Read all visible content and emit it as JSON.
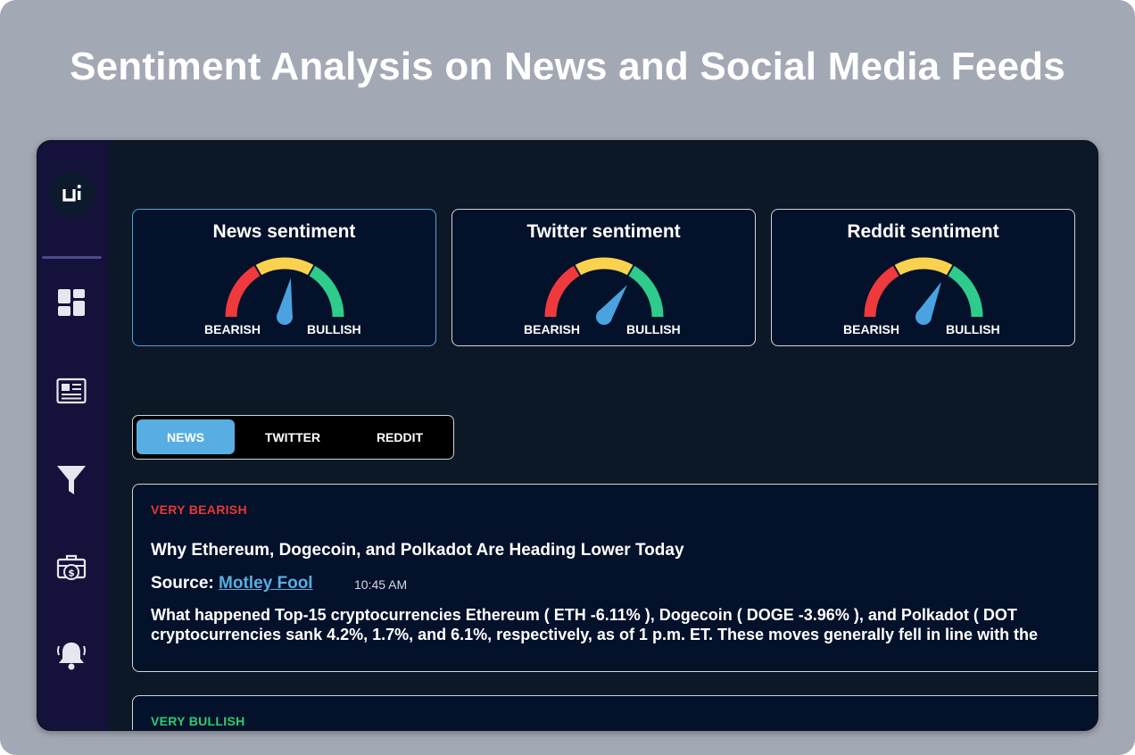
{
  "headline": "Sentiment Analysis on News and Social Media Feeds",
  "sidebar": {
    "logo_text": "ui",
    "icons": [
      "dashboard-icon",
      "newspaper-icon",
      "filter-icon",
      "briefcase-dollar-icon",
      "bell-icon"
    ]
  },
  "sentiment_cards": [
    {
      "title": "News sentiment",
      "left_label": "BEARISH",
      "right_label": "BULLISH",
      "needle_position": 0.55
    },
    {
      "title": "Twitter sentiment",
      "left_label": "BEARISH",
      "right_label": "BULLISH",
      "needle_position": 0.7
    },
    {
      "title": "Reddit sentiment",
      "left_label": "BEARISH",
      "right_label": "BULLISH",
      "needle_position": 0.65
    }
  ],
  "tabs": [
    {
      "label": "NEWS",
      "selected": true
    },
    {
      "label": "TWITTER",
      "selected": false
    },
    {
      "label": "REDDIT",
      "selected": false
    }
  ],
  "feed": [
    {
      "tag": "VERY BEARISH",
      "tag_color": "#e53935",
      "title": "Why Ethereum, Dogecoin, and Polkadot Are Heading Lower Today",
      "source_label": "Source:",
      "source_name": "Motley Fool",
      "time": "10:45 AM",
      "body_line1": "What happened Top-15 cryptocurrencies Ethereum ( ETH -6.11% ), Dogecoin ( DOGE -3.96% ), and Polkadot ( DOT",
      "body_line2": "cryptocurrencies sank 4.2%, 1.7%, and 6.1%, respectively, as of 1 p.m. ET. These moves generally fell in line with the"
    },
    {
      "tag": "VERY BULLISH",
      "tag_color": "#2ecc71"
    }
  ],
  "colors": {
    "gauge_red": "#f0393d",
    "gauge_yellow": "#fbd24e",
    "gauge_green": "#2ecc8a",
    "needle": "#4aa3e0",
    "accent": "#58aee3"
  }
}
